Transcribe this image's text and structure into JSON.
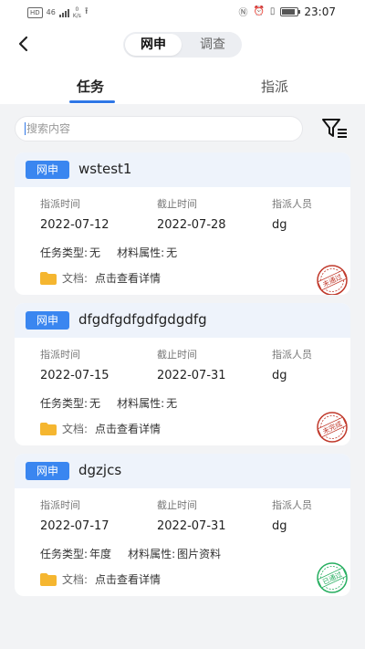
{
  "status_bar": {
    "network_badge": "HD",
    "network_type": "46",
    "speed_value": "0",
    "speed_unit": "K/s",
    "time": "23:07",
    "icons": [
      "nfc-icon",
      "alarm-icon",
      "vibrate-icon",
      "battery-icon",
      "usb-icon"
    ]
  },
  "header": {
    "segments": [
      "网申",
      "调查"
    ],
    "selected_segment": "网申"
  },
  "tabs": [
    "任务",
    "指派"
  ],
  "selected_tab": "任务",
  "search": {
    "placeholder": "搜索内容",
    "value": ""
  },
  "field_labels": {
    "assign_time": "指派时间",
    "deadline": "截止时间",
    "assignee": "指派人员",
    "task_type": "任务类型:",
    "material_attr": "材料属性:",
    "document": "文档:",
    "view_details": "点击查看详情"
  },
  "cards": [
    {
      "badge": "网申",
      "title": "wstest1",
      "assign_time": "2022-07-12",
      "deadline": "2022-07-28",
      "assignee": "dg",
      "task_type": "无",
      "material_attr": "无",
      "stamp": {
        "text": "未通过",
        "color": "#c0392b"
      }
    },
    {
      "badge": "网申",
      "title": "dfgdfgdfgdfgdgdfg",
      "assign_time": "2022-07-15",
      "deadline": "2022-07-31",
      "assignee": "dg",
      "task_type": "无",
      "material_attr": "无",
      "stamp": {
        "text": "未完成",
        "color": "#c0392b"
      }
    },
    {
      "badge": "网申",
      "title": "dgzjcs",
      "assign_time": "2022-07-17",
      "deadline": "2022-07-31",
      "assignee": "dg",
      "task_type": "年度",
      "material_attr": "图片资料",
      "stamp": {
        "text": "已通过",
        "color": "#27ae60"
      }
    }
  ],
  "colors": {
    "accent": "#2f77e6",
    "badge_bg": "#3a86f0",
    "card_head_bg": "#eef3fb",
    "page_bg": "#f2f3f5",
    "folder": "#f5b630"
  }
}
